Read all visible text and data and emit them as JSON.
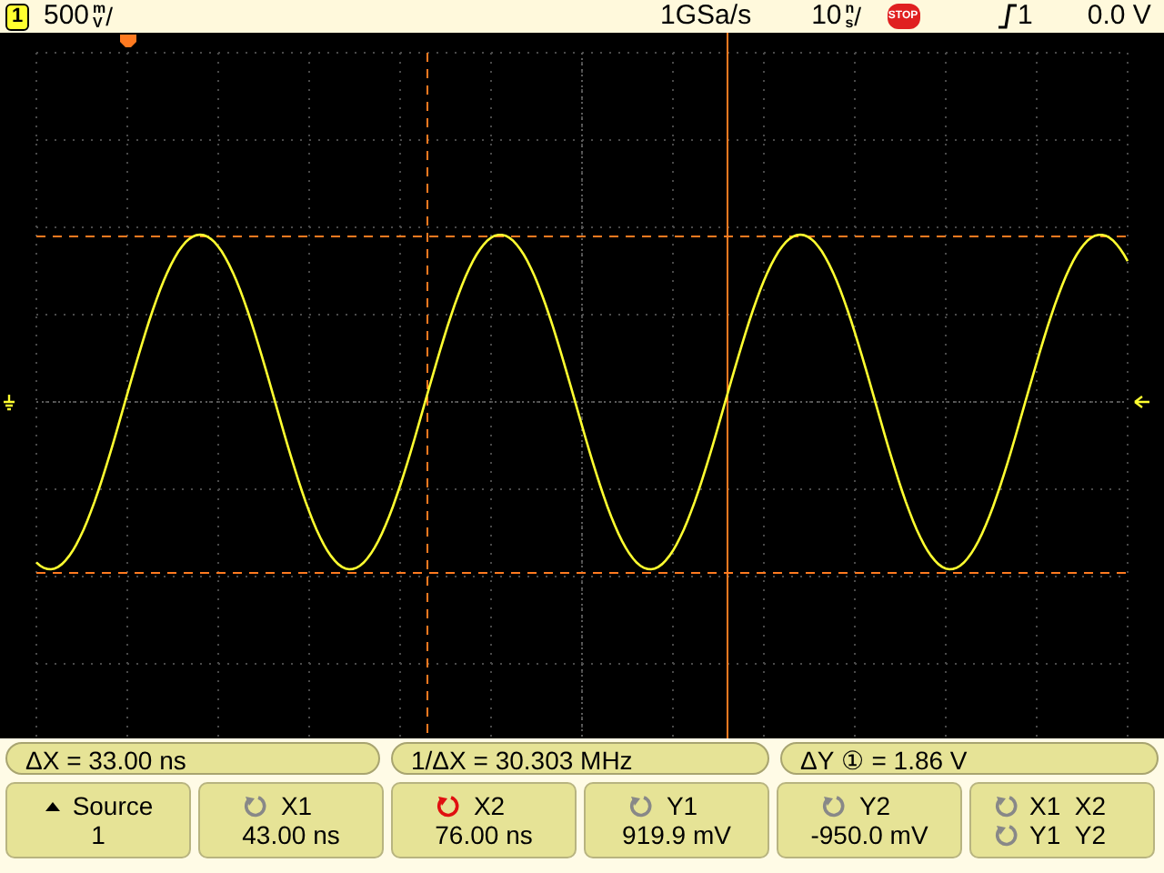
{
  "status_bar": {
    "channel": "1",
    "scale": "500",
    "unit_top": "m",
    "unit_bottom": "V",
    "slash": "/",
    "sample_rate": "1GSa/s",
    "timebase": "10",
    "time_unit_top": "n",
    "time_unit_bottom": "s",
    "time_slash": "/",
    "run_state": "STOP",
    "trigger_source": "1",
    "trigger_level": "0.0 V"
  },
  "measurements": [
    {
      "text": "ΔX = 33.00 ns"
    },
    {
      "text": "1/ΔX = 30.303 MHz"
    },
    {
      "text": "ΔY ① =  1.86  V"
    }
  ],
  "softkeys": [
    {
      "kind": "menu",
      "label": "Source",
      "value": "1"
    },
    {
      "kind": "knob",
      "label": "X1",
      "value": "43.00 ns",
      "active": false
    },
    {
      "kind": "knob",
      "label": "X2",
      "value": "76.00 ns",
      "active": true
    },
    {
      "kind": "knob",
      "label": "Y1",
      "value": "919.9 mV",
      "active": false
    },
    {
      "kind": "knob",
      "label": "Y2",
      "value": "-950.0 mV",
      "active": false
    },
    {
      "kind": "dual",
      "lines": [
        {
          "label": "X1",
          "label2": "X2",
          "active": false
        },
        {
          "label": "Y1",
          "label2": "Y2",
          "active": false
        }
      ]
    }
  ]
}
